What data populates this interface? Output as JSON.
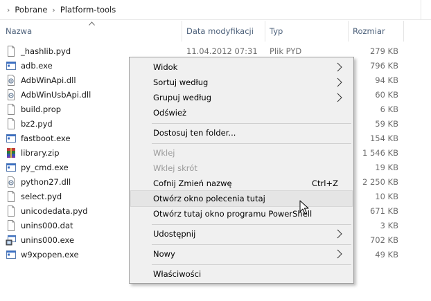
{
  "breadcrumb": {
    "items": [
      "Pobrane",
      "Platform-tools"
    ],
    "separator": "›"
  },
  "columns": {
    "name": "Nazwa",
    "date": "Data modyfikacji",
    "type": "Typ",
    "size": "Rozmiar"
  },
  "files": [
    {
      "name": "_hashlib.pyd",
      "date": "11.04.2012 07:31",
      "type": "Plik PYD",
      "size": "279 KB",
      "icon": "file-icon"
    },
    {
      "name": "adb.exe",
      "date": "",
      "type": "",
      "size": "796 KB",
      "icon": "exe-icon"
    },
    {
      "name": "AdbWinApi.dll",
      "date": "",
      "type": "",
      "size": "94 KB",
      "icon": "dll-icon"
    },
    {
      "name": "AdbWinUsbApi.dll",
      "date": "",
      "type": "",
      "size": "60 KB",
      "icon": "dll-icon"
    },
    {
      "name": "build.prop",
      "date": "",
      "type": "",
      "size": "6 KB",
      "icon": "file-icon"
    },
    {
      "name": "bz2.pyd",
      "date": "",
      "type": "",
      "size": "59 KB",
      "icon": "file-icon"
    },
    {
      "name": "fastboot.exe",
      "date": "",
      "type": "",
      "size": "154 KB",
      "icon": "exe-icon"
    },
    {
      "name": "library.zip",
      "date": "",
      "type": "",
      "size": "1 546 KB",
      "icon": "zip-icon"
    },
    {
      "name": "py_cmd.exe",
      "date": "",
      "type": "",
      "size": "19 KB",
      "icon": "exe-icon"
    },
    {
      "name": "python27.dll",
      "date": "",
      "type": "",
      "size": "2 250 KB",
      "icon": "dll-icon"
    },
    {
      "name": "select.pyd",
      "date": "",
      "type": "",
      "size": "10 KB",
      "icon": "file-icon"
    },
    {
      "name": "unicodedata.pyd",
      "date": "",
      "type": "",
      "size": "671 KB",
      "icon": "file-icon"
    },
    {
      "name": "unins000.dat",
      "date": "",
      "type": "",
      "size": "3 KB",
      "icon": "file-icon"
    },
    {
      "name": "unins000.exe",
      "date": "",
      "type": "",
      "size": "702 KB",
      "icon": "installer-icon"
    },
    {
      "name": "w9xpopen.exe",
      "date": "",
      "type": "",
      "size": "49 KB",
      "icon": "exe-icon"
    }
  ],
  "context_menu": {
    "view": "Widok",
    "sort_by": "Sortuj według",
    "group_by": "Grupuj według",
    "refresh": "Odśwież",
    "customize": "Dostosuj ten folder...",
    "paste": "Wklej",
    "paste_shortcut": "Wklej skrót",
    "undo": "Cofnij Zmień nazwę",
    "undo_shortcut": "Ctrl+Z",
    "open_cmd": "Otwórz okno polecenia tutaj",
    "open_powershell": "Otwórz tutaj okno programu PowerShell",
    "share": "Udostępnij",
    "new": "Nowy",
    "properties": "Właściwości"
  },
  "colors": {
    "header_text": "#4c607a",
    "menu_bg": "#f0f0f0",
    "menu_hover": "#e5e5e5",
    "disabled_text": "#9a9a9a"
  }
}
